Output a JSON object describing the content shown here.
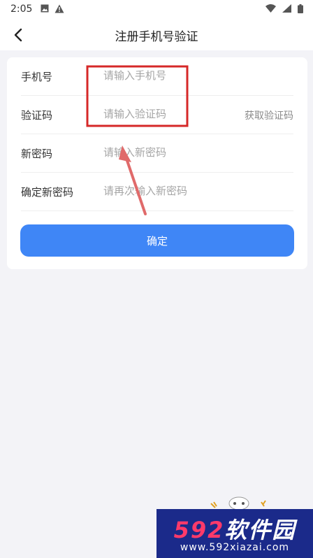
{
  "status_bar": {
    "time": "2:05",
    "left_icons": [
      "photo-icon",
      "warning-icon"
    ],
    "right_icons": [
      "wifi-icon",
      "signal-icon",
      "battery-icon"
    ]
  },
  "nav": {
    "back_icon": "chevron-left-icon",
    "title": "注册手机号验证"
  },
  "form": {
    "rows": [
      {
        "label": "手机号",
        "placeholder": "请输入手机号",
        "value": ""
      },
      {
        "label": "验证码",
        "placeholder": "请输入验证码",
        "value": "",
        "action": "获取验证码"
      },
      {
        "label": "新密码",
        "placeholder": "请输入新密码",
        "value": ""
      },
      {
        "label": "确定新密码",
        "placeholder": "请再次输入新密码",
        "value": ""
      }
    ],
    "submit_label": "确定"
  },
  "watermark": {
    "brand_number": "592",
    "brand_text": "软件园",
    "url": "www.592xiazai.com"
  },
  "colors": {
    "accent": "#3f86f6",
    "background": "#f3f3f7",
    "annotation": "#d62828"
  }
}
